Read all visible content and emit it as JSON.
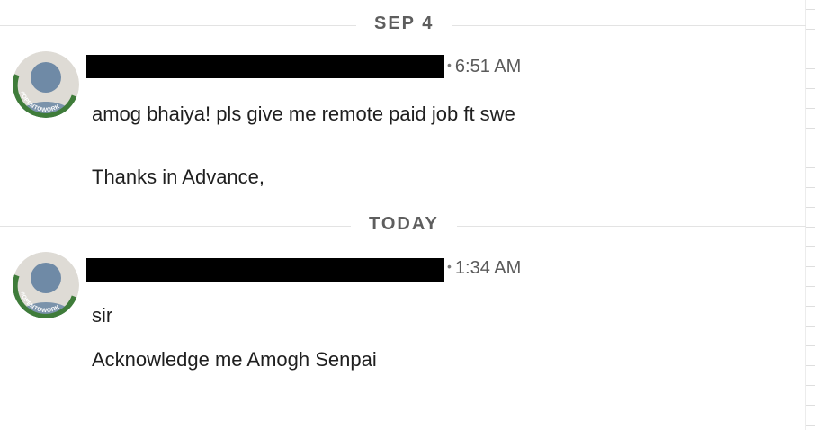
{
  "date_dividers": [
    {
      "label": "SEP 4"
    },
    {
      "label": "TODAY"
    }
  ],
  "messages": [
    {
      "avatar_badge_text": "#OPENTOWORK",
      "separator": "•",
      "timestamp": "6:51 AM",
      "lines": [
        "amog bhaiya! pls give me remote paid job ft swe",
        "Thanks in Advance,"
      ]
    },
    {
      "avatar_badge_text": "#OPENTOWORK",
      "separator": "•",
      "timestamp": "1:34 AM",
      "lines": [
        "sir",
        "Acknowledge me Amogh Senpai"
      ]
    }
  ],
  "colors": {
    "open_to_work_green": "#3f7c3a",
    "avatar_bg": "#dedbd5",
    "avatar_figure": "#6f8aa6",
    "redaction": "#000000"
  }
}
